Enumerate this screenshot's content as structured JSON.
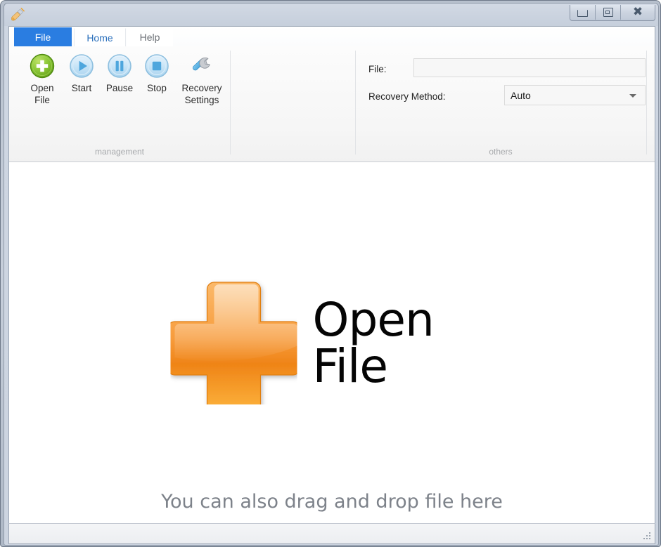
{
  "window": {
    "app_icon": "wizard-brush-icon",
    "title": "",
    "minimize_label": "Minimize",
    "maximize_label": "Maximize",
    "close_label": "Close"
  },
  "ribbon": {
    "tabs": [
      {
        "id": "file",
        "label": "File",
        "state": "menu"
      },
      {
        "id": "home",
        "label": "Home",
        "state": "active"
      },
      {
        "id": "help",
        "label": "Help",
        "state": "normal"
      }
    ],
    "groups": [
      {
        "id": "management",
        "label": "management",
        "buttons": [
          {
            "id": "open-file",
            "label_line1": "Open",
            "label_line2": "File",
            "icon": "green-plus-circle-icon",
            "enabled": true
          },
          {
            "id": "start",
            "label_line1": "Start",
            "label_line2": "",
            "icon": "play-circle-icon",
            "enabled": false
          },
          {
            "id": "pause",
            "label_line1": "Pause",
            "label_line2": "",
            "icon": "pause-circle-icon",
            "enabled": false
          },
          {
            "id": "stop",
            "label_line1": "Stop",
            "label_line2": "",
            "icon": "stop-circle-icon",
            "enabled": false
          },
          {
            "id": "recovery-settings",
            "label_line1": "Recovery",
            "label_line2": "Settings",
            "icon": "wrench-icon",
            "enabled": true
          }
        ]
      },
      {
        "id": "others",
        "label": "others",
        "fields": {
          "file_label": "File:",
          "file_value": "",
          "file_placeholder": "",
          "recovery_method_label": "Recovery Method:",
          "recovery_method_value": "Auto",
          "recovery_method_options": [
            "Auto"
          ]
        }
      }
    ]
  },
  "main": {
    "open_file_cta": "Open File",
    "open_file_icon": "orange-plus-icon",
    "drag_hint": "You can also drag and drop file here"
  },
  "statusbar": {
    "text": "",
    "grip": "resize-grip-icon"
  },
  "colors": {
    "tab_file_bg": "#2a7de1",
    "tab_active_text": "#2a6fbc",
    "plus_orange_light": "#f9a84e",
    "plus_orange_dark": "#f08a12",
    "green_icon": "#7ab929",
    "hint_gray": "#7d828a"
  }
}
